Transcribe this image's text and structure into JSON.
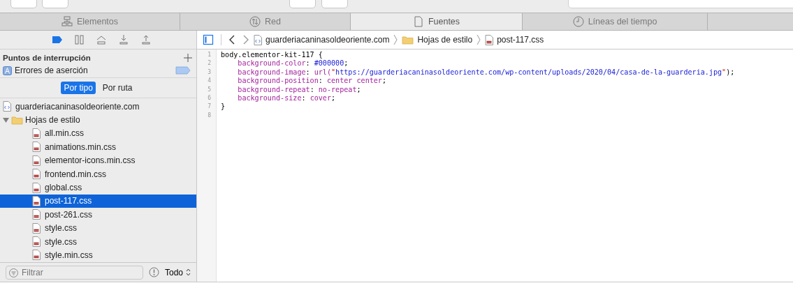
{
  "tabs": [
    {
      "label": "Elementos",
      "selected": false
    },
    {
      "label": "Red",
      "selected": false
    },
    {
      "label": "Fuentes",
      "selected": true
    },
    {
      "label": "Líneas del tiempo",
      "selected": false
    }
  ],
  "debugger_toolbar": [
    {
      "kind": "breakpoints",
      "on": true
    },
    {
      "kind": "pause",
      "on": false
    },
    {
      "kind": "step-over",
      "on": false
    },
    {
      "kind": "step-into",
      "on": false
    },
    {
      "kind": "step-out",
      "on": false
    }
  ],
  "breakpoints": {
    "title": "Puntos de interrupción",
    "items": [
      {
        "label": "Errores de aserción",
        "enabled": false
      }
    ]
  },
  "scope": [
    {
      "label": "Por tipo",
      "selected": true
    },
    {
      "label": "Por ruta",
      "selected": false
    }
  ],
  "tree": [
    {
      "label": "guarderiacaninasoldeoriente.com",
      "kind": "document",
      "children": [
        {
          "label": "Hojas de estilo",
          "kind": "folder",
          "expanded": true,
          "children": [
            {
              "label": "all.min.css",
              "kind": "css",
              "selected": false
            },
            {
              "label": "animations.min.css",
              "kind": "css",
              "selected": false
            },
            {
              "label": "elementor-icons.min.css",
              "kind": "css",
              "selected": false
            },
            {
              "label": "frontend.min.css",
              "kind": "css",
              "selected": false
            },
            {
              "label": "global.css",
              "kind": "css",
              "selected": false
            },
            {
              "label": "post-117.css",
              "kind": "css",
              "selected": true
            },
            {
              "label": "post-261.css",
              "kind": "css",
              "selected": false
            },
            {
              "label": "style.css",
              "kind": "css",
              "selected": false
            },
            {
              "label": "style.css",
              "kind": "css",
              "selected": false
            },
            {
              "label": "style.min.css",
              "kind": "css",
              "selected": false
            }
          ]
        }
      ]
    }
  ],
  "filter": {
    "placeholder": "Filtrar",
    "dropdown": "Todo"
  },
  "breadcrumbs": [
    {
      "label": "guarderiacaninasoldeoriente.com",
      "kind": "document"
    },
    {
      "label": "Hojas de estilo",
      "kind": "folder"
    },
    {
      "label": "post-117.css",
      "kind": "css"
    }
  ],
  "code_lines": [
    {
      "number": "1",
      "tokens": [
        {
          "text": "body.elementor-kit-117 {",
          "kind": "plain"
        }
      ]
    },
    {
      "number": "2",
      "tokens": [
        {
          "text": "    background-color",
          "kind": "property"
        },
        {
          "text": ": ",
          "kind": "plain"
        },
        {
          "text": "#000000",
          "kind": "number"
        },
        {
          "text": ";",
          "kind": "plain"
        }
      ]
    },
    {
      "number": "3",
      "tokens": [
        {
          "text": "    background-image",
          "kind": "property"
        },
        {
          "text": ": ",
          "kind": "plain"
        },
        {
          "text": "url(",
          "kind": "value"
        },
        {
          "text": "\"",
          "kind": "string-quote"
        },
        {
          "text": "https://guarderiacaninasoldeoriente.com/wp-content/uploads/2020/04/casa-de-la-guarderia.jpg",
          "kind": "string"
        },
        {
          "text": "\"",
          "kind": "string-quote"
        },
        {
          "text": ");",
          "kind": "plain"
        }
      ]
    },
    {
      "number": "4",
      "tokens": [
        {
          "text": "    background-position",
          "kind": "property"
        },
        {
          "text": ": ",
          "kind": "plain"
        },
        {
          "text": "center center",
          "kind": "value"
        },
        {
          "text": ";",
          "kind": "plain"
        }
      ]
    },
    {
      "number": "5",
      "tokens": [
        {
          "text": "    background-repeat",
          "kind": "property"
        },
        {
          "text": ": ",
          "kind": "plain"
        },
        {
          "text": "no-repeat",
          "kind": "value"
        },
        {
          "text": ";",
          "kind": "plain"
        }
      ]
    },
    {
      "number": "6",
      "tokens": [
        {
          "text": "    background-size",
          "kind": "property"
        },
        {
          "text": ": ",
          "kind": "plain"
        },
        {
          "text": "cover",
          "kind": "value"
        },
        {
          "text": ";",
          "kind": "plain"
        }
      ]
    },
    {
      "number": "7",
      "tokens": [
        {
          "text": "}",
          "kind": "plain"
        }
      ]
    },
    {
      "number": "8"
    }
  ]
}
